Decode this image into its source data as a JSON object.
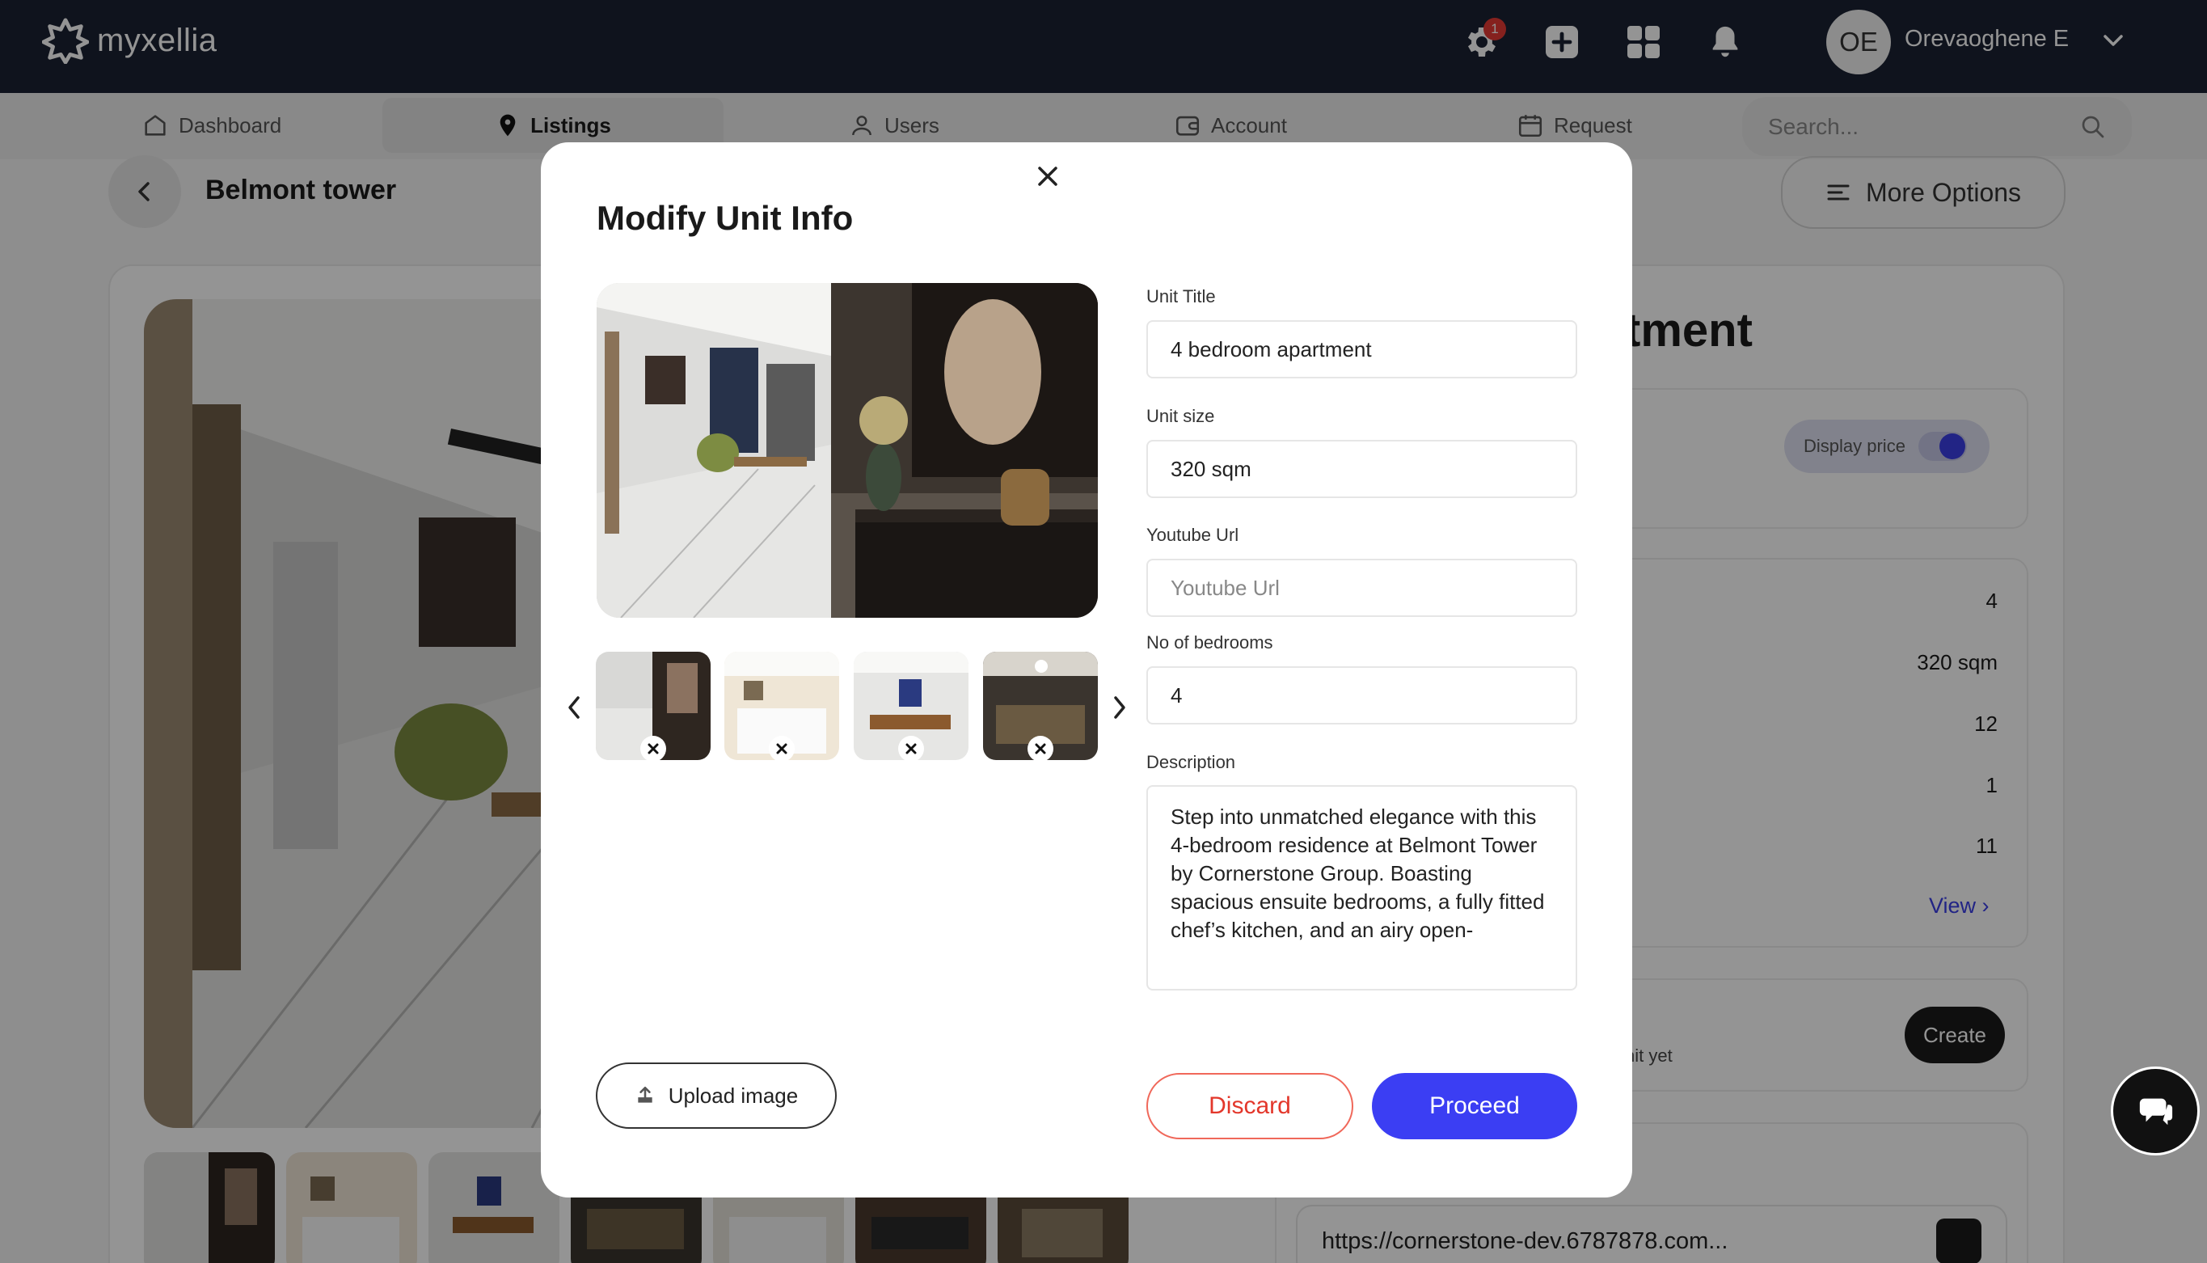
{
  "brand": {
    "name": "myxellia"
  },
  "topbar": {
    "settings_badge": "1",
    "user_initials": "OE",
    "user_name": "Orevaoghene E"
  },
  "nav": {
    "items": [
      {
        "label": "Dashboard",
        "icon": "home-icon"
      },
      {
        "label": "Listings",
        "icon": "location-pin-icon",
        "active": true
      },
      {
        "label": "Users",
        "icon": "user-icon"
      },
      {
        "label": "Account",
        "icon": "wallet-icon"
      },
      {
        "label": "Request",
        "icon": "calendar-icon"
      }
    ],
    "search_placeholder": "Search..."
  },
  "page": {
    "title": "Belmont tower",
    "more_options_label": "More Options",
    "unit_heading_partial": "tment",
    "display_price_label": "Display price",
    "details_values": [
      "4",
      "320 sqm",
      "12",
      "1",
      "11"
    ],
    "view_label": "View ›",
    "no_unit_text": "nit yet",
    "create_label": "Create",
    "share_url": "https://cornerstone-dev.6787878.com..."
  },
  "modal": {
    "title": "Modify Unit Info",
    "thumbnail_count": 4,
    "fields": {
      "unit_title": {
        "label": "Unit Title",
        "value": "4 bedroom apartment"
      },
      "unit_size": {
        "label": "Unit size",
        "value": "320 sqm"
      },
      "youtube_url": {
        "label": "Youtube Url",
        "placeholder": "Youtube Url",
        "value": ""
      },
      "bedrooms": {
        "label": "No of bedrooms",
        "value": "4"
      },
      "description": {
        "label": "Description",
        "value": "Step into unmatched elegance with this 4-bedroom residence at Belmont Tower by Cornerstone Group. Boasting spacious ensuite bedrooms, a fully fitted chef’s kitchen, and an airy open-"
      }
    },
    "upload_label": "Upload image",
    "discard_label": "Discard",
    "proceed_label": "Proceed"
  },
  "colors": {
    "topbar": "#1b2233",
    "accent": "#3b3ef3",
    "danger": "#e3372b",
    "badge": "#e53935"
  }
}
